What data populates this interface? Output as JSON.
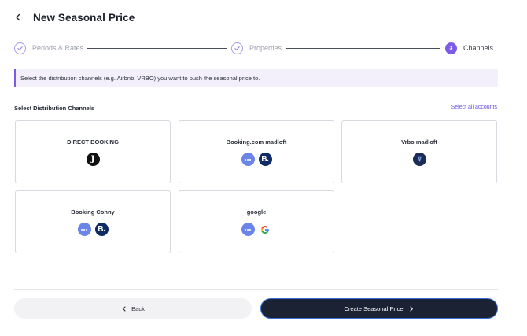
{
  "header": {
    "title": "New Seasonal Price"
  },
  "stepper": {
    "steps": [
      {
        "label": "Periods & Rates",
        "state": "done"
      },
      {
        "label": "Properties",
        "state": "done"
      },
      {
        "number": "3",
        "label": "Channels",
        "state": "active"
      }
    ]
  },
  "info": {
    "text": "Select the distribution channels (e.g. Airbnb, VRBO) you want to push the seasonal price to."
  },
  "section": {
    "title": "Select Distribution Channels",
    "select_all": "Select all accounts"
  },
  "channels": [
    {
      "name": "DIRECT BOOKING",
      "icons": [
        "direct-booking-logo-icon"
      ]
    },
    {
      "name": "Booking.com madloft",
      "icons": [
        "more-icon",
        "booking-com-logo-icon"
      ]
    },
    {
      "name": "Vrbo madloft",
      "icons": [
        "vrbo-logo-icon"
      ]
    },
    {
      "name": "Booking Conny",
      "icons": [
        "more-icon",
        "booking-com-logo-icon"
      ]
    },
    {
      "name": "google",
      "icons": [
        "more-icon",
        "google-logo-icon"
      ]
    }
  ],
  "footer": {
    "back_label": "Back",
    "create_label": "Create Seasonal Price"
  },
  "colors": {
    "accent": "#7c5ce6",
    "primary_button": "#1a2234",
    "info_bg": "#f3f0fc",
    "booking_blue": "#0f2b66"
  }
}
